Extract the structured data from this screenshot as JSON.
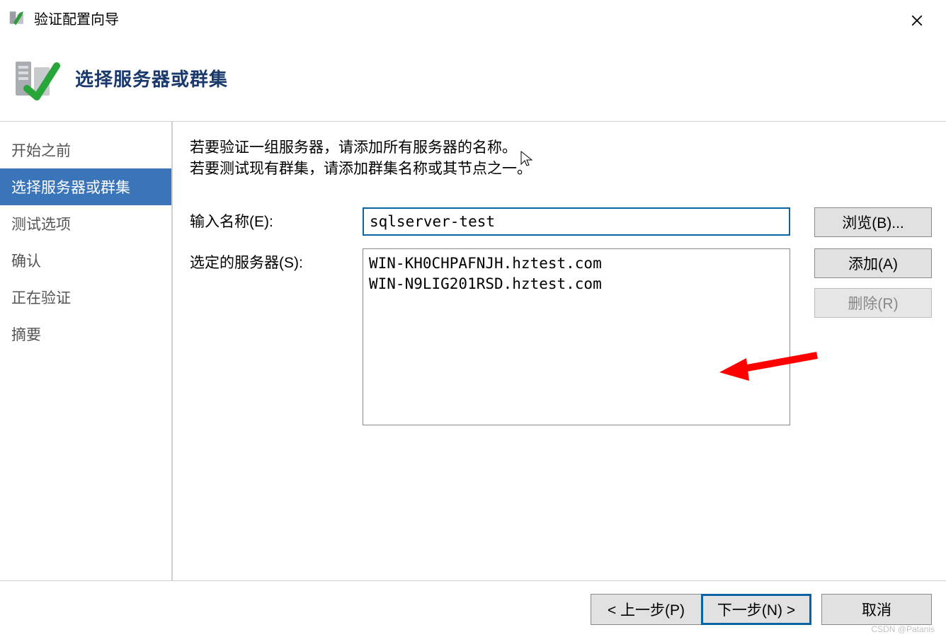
{
  "title": "验证配置向导",
  "header": {
    "title": "选择服务器或群集"
  },
  "sidebar": {
    "items": [
      {
        "label": "开始之前"
      },
      {
        "label": "选择服务器或群集",
        "active": true
      },
      {
        "label": "测试选项"
      },
      {
        "label": "确认"
      },
      {
        "label": "正在验证"
      },
      {
        "label": "摘要"
      }
    ]
  },
  "content": {
    "instruction_line1": "若要验证一组服务器，请添加所有服务器的名称。",
    "instruction_line2": "若要测试现有群集，请添加群集名称或其节点之一。",
    "enter_name_label": "输入名称(E):",
    "selected_servers_label": "选定的服务器(S):",
    "name_input_value": "sqlserver-test",
    "servers": [
      "WIN-KH0CHPAFNJH.hztest.com",
      "WIN-N9LIG201RSD.hztest.com"
    ],
    "browse_label": "浏览(B)...",
    "add_label": "添加(A)",
    "remove_label": "删除(R)"
  },
  "footer": {
    "prev_label": "< 上一步(P)",
    "next_label": "下一步(N) >",
    "cancel_label": "取消"
  },
  "icons": {
    "title_icon": "cluster-wizard-icon",
    "header_icon": "cluster-check-icon",
    "close": "close-icon"
  },
  "watermark": "CSDN @Patanis"
}
